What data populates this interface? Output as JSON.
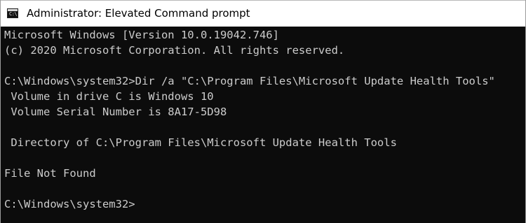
{
  "window": {
    "title": "Administrator: Elevated Command prompt",
    "icon": "cmd-icon"
  },
  "console": {
    "lines": [
      "Microsoft Windows [Version 10.0.19042.746]",
      "(c) 2020 Microsoft Corporation. All rights reserved.",
      "",
      "C:\\Windows\\system32>Dir /a \"C:\\Program Files\\Microsoft Update Health Tools\"",
      " Volume in drive C is Windows 10",
      " Volume Serial Number is 8A17-5D98",
      "",
      " Directory of C:\\Program Files\\Microsoft Update Health Tools",
      "",
      "File Not Found",
      "",
      "C:\\Windows\\system32>"
    ]
  },
  "colors": {
    "console_background": "#0c0c0c",
    "console_text": "#cccccc",
    "titlebar_background": "#ffffff"
  }
}
